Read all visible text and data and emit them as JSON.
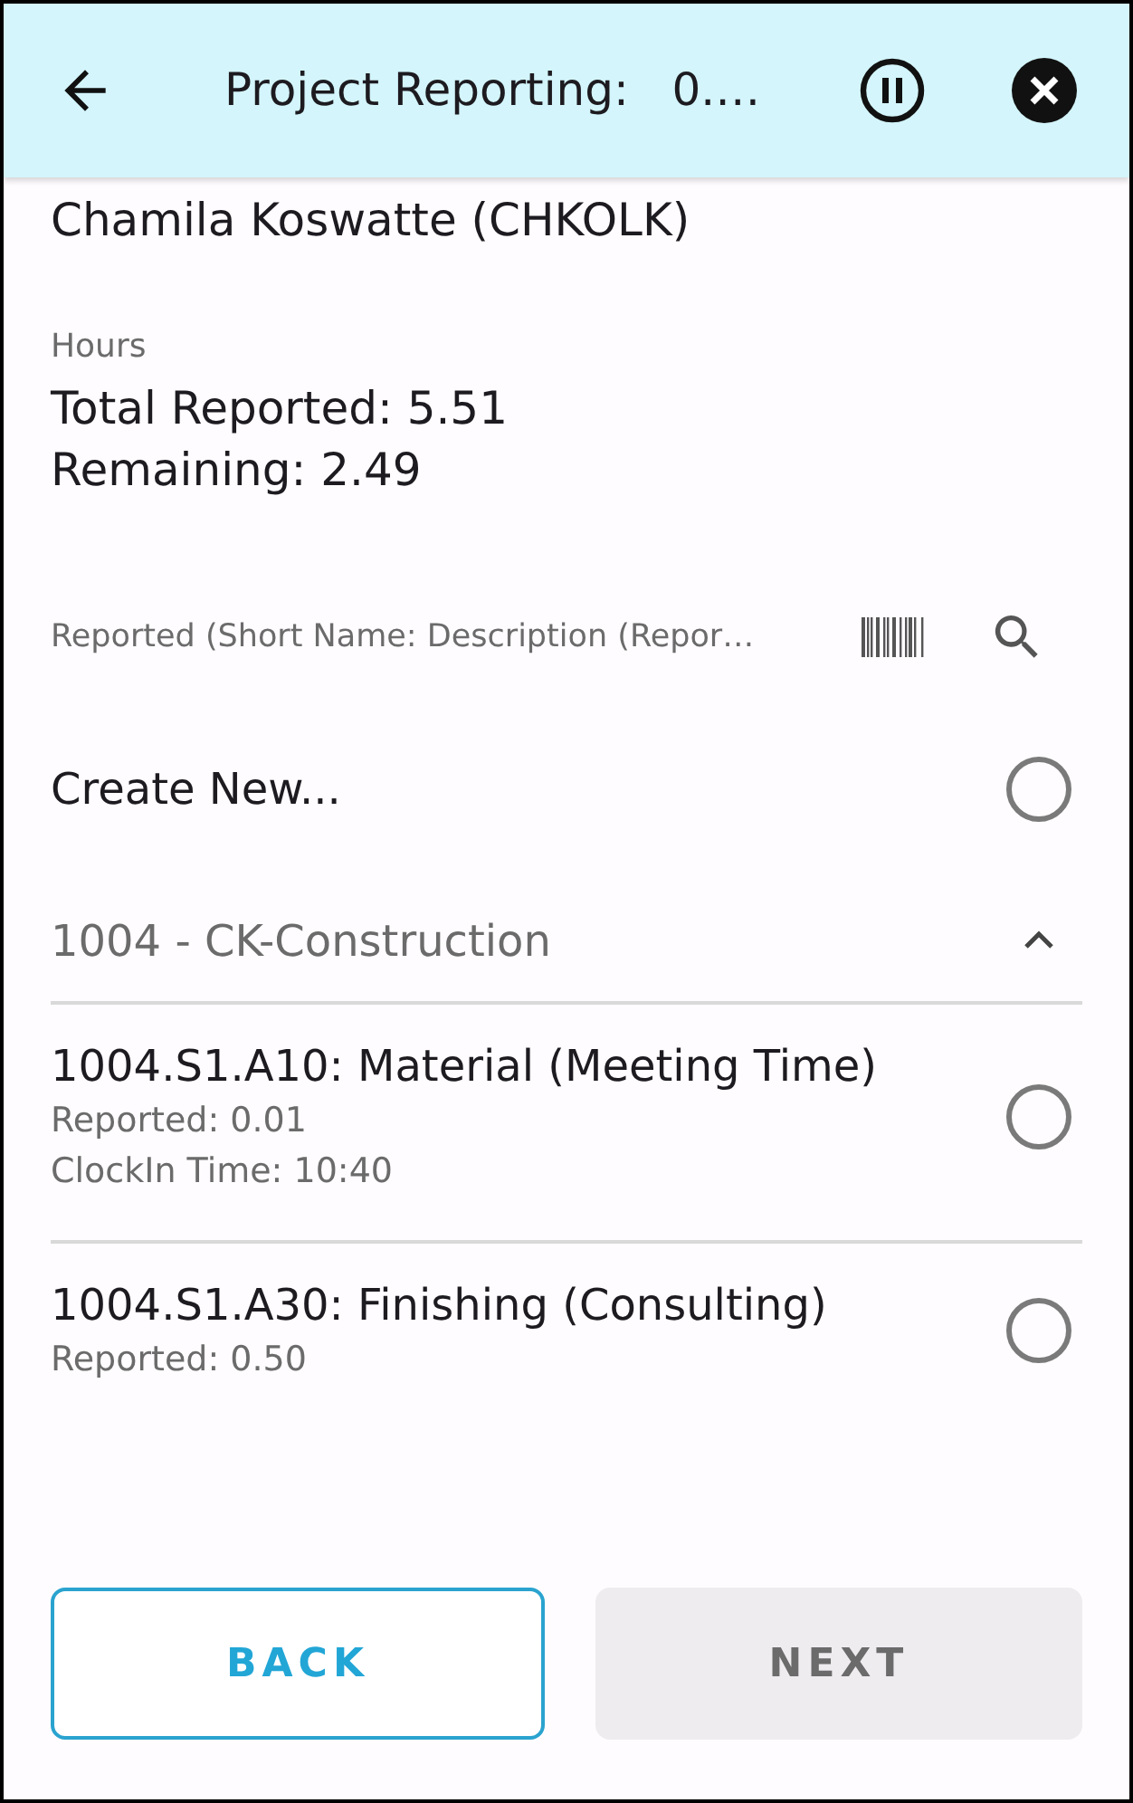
{
  "header": {
    "title": "Project Reporting:   0.…"
  },
  "employee": "Chamila Koswatte (CHKOLK)",
  "hours": {
    "label": "Hours",
    "lines": [
      "Total Reported: 5.51",
      "Remaining: 2.49"
    ]
  },
  "search": {
    "placeholder": "Reported (Short Name: Description (Repor…"
  },
  "create_new": {
    "label": "Create New...",
    "selected": false
  },
  "group": {
    "title": "1004 - CK-Construction",
    "expanded": true,
    "items": [
      {
        "title": "1004.S1.A10: Material (Meeting Time)",
        "lines": [
          "Reported: 0.01",
          "ClockIn Time: 10:40"
        ],
        "selected": false
      },
      {
        "title": "1004.S1.A30: Finishing (Consulting)",
        "lines": [
          "Reported: 0.50"
        ],
        "selected": false
      }
    ]
  },
  "buttons": [
    {
      "label": "BACK",
      "disabled": false
    },
    {
      "label": "NEXT",
      "disabled": true
    }
  ]
}
